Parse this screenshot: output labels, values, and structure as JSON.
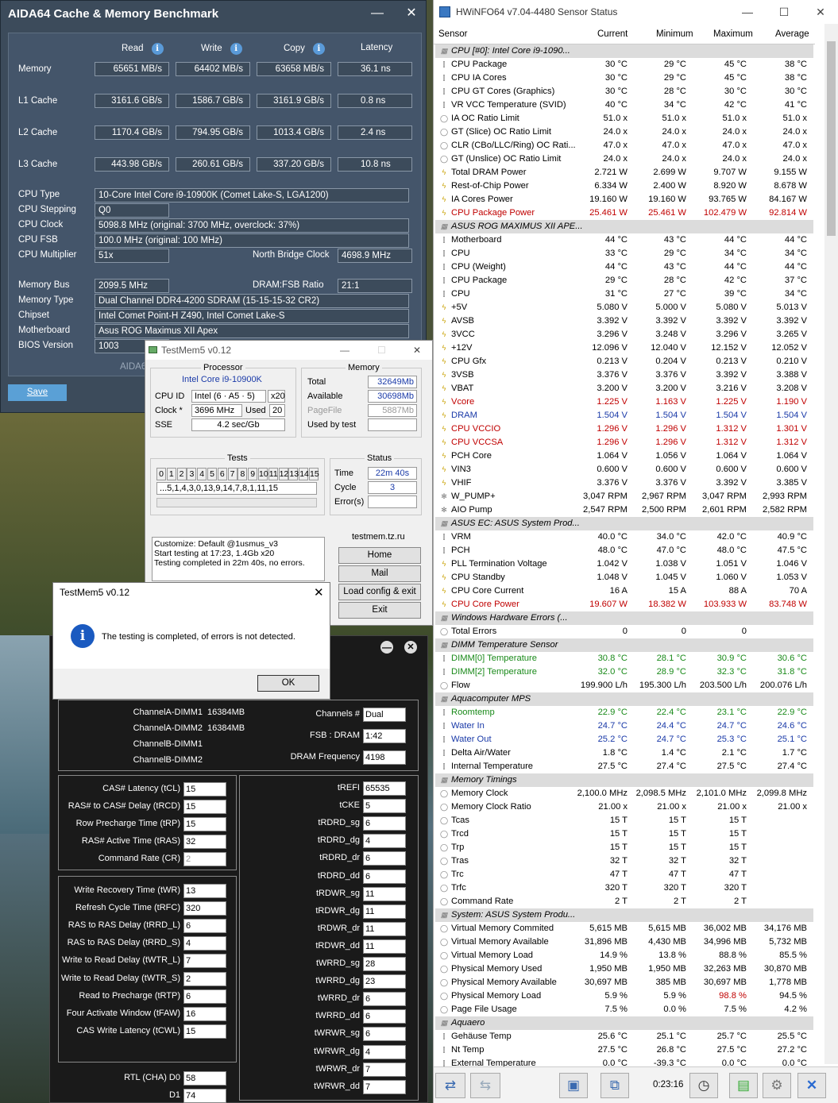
{
  "aida": {
    "title": "AIDA64 Cache & Memory Benchmark",
    "save": "Save",
    "watermark": "AIDA6",
    "cols": {
      "read": "Read",
      "write": "Write",
      "copy": "Copy",
      "latency": "Latency"
    },
    "rows": [
      {
        "label": "Memory",
        "read": "65651 MB/s",
        "write": "64402 MB/s",
        "copy": "63658 MB/s",
        "latency": "36.1 ns"
      },
      {
        "label": "L1 Cache",
        "read": "3161.6 GB/s",
        "write": "1586.7 GB/s",
        "copy": "3161.9 GB/s",
        "latency": "0.8 ns"
      },
      {
        "label": "L2 Cache",
        "read": "1170.4 GB/s",
        "write": "794.95 GB/s",
        "copy": "1013.4 GB/s",
        "latency": "2.4 ns"
      },
      {
        "label": "L3 Cache",
        "read": "443.98 GB/s",
        "write": "260.61 GB/s",
        "copy": "337.20 GB/s",
        "latency": "10.8 ns"
      }
    ],
    "info": {
      "cpu_type_l": "CPU Type",
      "cpu_type": "10-Core Intel Core i9-10900K (Comet Lake-S, LGA1200)",
      "stepping_l": "CPU Stepping",
      "stepping": "Q0",
      "clock_l": "CPU Clock",
      "clock": "5098.8 MHz (original: 3700 MHz, overclock: 37%)",
      "fsb_l": "CPU FSB",
      "fsb": "100.0 MHz (original: 100 MHz)",
      "mult_l": "CPU Multiplier",
      "mult": "51x",
      "nb_l": "North Bridge Clock",
      "nb": "4698.9 MHz",
      "membus_l": "Memory Bus",
      "membus": "2099.5 MHz",
      "ratio_l": "DRAM:FSB Ratio",
      "ratio": "21:1",
      "memtype_l": "Memory Type",
      "memtype": "Dual Channel DDR4-4200 SDRAM (15-15-15-32 CR2)",
      "chipset_l": "Chipset",
      "chipset": "Intel Comet Point-H Z490, Intel Comet Lake-S",
      "mobo_l": "Motherboard",
      "mobo": "Asus ROG Maximus XII Apex",
      "bios_l": "BIOS Version",
      "bios": "1003"
    }
  },
  "hw": {
    "title": "HWiNFO64 v7.04-4480 Sensor Status",
    "cols": [
      "Sensor",
      "Current",
      "Minimum",
      "Maximum",
      "Average"
    ],
    "time": "0:23:16",
    "rows": [
      {
        "s": 1,
        "n": "CPU [#0]: Intel Core i9-1090..."
      },
      {
        "i": "t",
        "n": "CPU Package",
        "c": "30 °C",
        "mi": "29 °C",
        "ma": "45 °C",
        "a": "38 °C"
      },
      {
        "i": "t",
        "n": "CPU IA Cores",
        "c": "30 °C",
        "mi": "29 °C",
        "ma": "45 °C",
        "a": "38 °C"
      },
      {
        "i": "t",
        "n": "CPU GT Cores (Graphics)",
        "c": "30 °C",
        "mi": "28 °C",
        "ma": "30 °C",
        "a": "30 °C"
      },
      {
        "i": "t",
        "n": "VR VCC Temperature (SVID)",
        "c": "40 °C",
        "mi": "34 °C",
        "ma": "42 °C",
        "a": "41 °C"
      },
      {
        "i": "o",
        "n": "IA OC Ratio Limit",
        "c": "51.0 x",
        "mi": "51.0 x",
        "ma": "51.0 x",
        "a": "51.0 x"
      },
      {
        "i": "o",
        "n": "GT (Slice) OC Ratio Limit",
        "c": "24.0 x",
        "mi": "24.0 x",
        "ma": "24.0 x",
        "a": "24.0 x"
      },
      {
        "i": "o",
        "n": "CLR (CBo/LLC/Ring) OC Rati...",
        "c": "47.0 x",
        "mi": "47.0 x",
        "ma": "47.0 x",
        "a": "47.0 x"
      },
      {
        "i": "o",
        "n": "GT (Unslice) OC Ratio Limit",
        "c": "24.0 x",
        "mi": "24.0 x",
        "ma": "24.0 x",
        "a": "24.0 x"
      },
      {
        "i": "p",
        "n": "Total DRAM Power",
        "c": "2.721 W",
        "mi": "2.699 W",
        "ma": "9.707 W",
        "a": "9.155 W"
      },
      {
        "i": "p",
        "n": "Rest-of-Chip Power",
        "c": "6.334 W",
        "mi": "2.400 W",
        "ma": "8.920 W",
        "a": "8.678 W"
      },
      {
        "i": "p",
        "n": "IA Cores Power",
        "c": "19.160 W",
        "mi": "19.160 W",
        "ma": "93.765 W",
        "a": "84.167 W"
      },
      {
        "i": "p",
        "n": "CPU Package Power",
        "c": "25.461 W",
        "mi": "25.461 W",
        "ma": "102.479 W",
        "a": "92.814 W",
        "k": "red"
      },
      {
        "s": 1,
        "n": "ASUS ROG MAXIMUS XII APE..."
      },
      {
        "i": "t",
        "n": "Motherboard",
        "c": "44 °C",
        "mi": "43 °C",
        "ma": "44 °C",
        "a": "44 °C"
      },
      {
        "i": "t",
        "n": "CPU",
        "c": "33 °C",
        "mi": "29 °C",
        "ma": "34 °C",
        "a": "34 °C"
      },
      {
        "i": "t",
        "n": "CPU (Weight)",
        "c": "44 °C",
        "mi": "43 °C",
        "ma": "44 °C",
        "a": "44 °C"
      },
      {
        "i": "t",
        "n": "CPU Package",
        "c": "29 °C",
        "mi": "28 °C",
        "ma": "42 °C",
        "a": "37 °C"
      },
      {
        "i": "t",
        "n": "CPU",
        "c": "31 °C",
        "mi": "27 °C",
        "ma": "39 °C",
        "a": "34 °C"
      },
      {
        "i": "p",
        "n": "+5V",
        "c": "5.080 V",
        "mi": "5.000 V",
        "ma": "5.080 V",
        "a": "5.013 V"
      },
      {
        "i": "p",
        "n": "AVSB",
        "c": "3.392 V",
        "mi": "3.392 V",
        "ma": "3.392 V",
        "a": "3.392 V"
      },
      {
        "i": "p",
        "n": "3VCC",
        "c": "3.296 V",
        "mi": "3.248 V",
        "ma": "3.296 V",
        "a": "3.265 V"
      },
      {
        "i": "p",
        "n": "+12V",
        "c": "12.096 V",
        "mi": "12.040 V",
        "ma": "12.152 V",
        "a": "12.052 V"
      },
      {
        "i": "p",
        "n": "CPU Gfx",
        "c": "0.213 V",
        "mi": "0.204 V",
        "ma": "0.213 V",
        "a": "0.210 V"
      },
      {
        "i": "p",
        "n": "3VSB",
        "c": "3.376 V",
        "mi": "3.376 V",
        "ma": "3.392 V",
        "a": "3.388 V"
      },
      {
        "i": "p",
        "n": "VBAT",
        "c": "3.200 V",
        "mi": "3.200 V",
        "ma": "3.216 V",
        "a": "3.208 V"
      },
      {
        "i": "p",
        "n": "Vcore",
        "c": "1.225 V",
        "mi": "1.163 V",
        "ma": "1.225 V",
        "a": "1.190 V",
        "k": "red"
      },
      {
        "i": "p",
        "n": "DRAM",
        "c": "1.504 V",
        "mi": "1.504 V",
        "ma": "1.504 V",
        "a": "1.504 V",
        "k": "blue"
      },
      {
        "i": "p",
        "n": "CPU VCCIO",
        "c": "1.296 V",
        "mi": "1.296 V",
        "ma": "1.312 V",
        "a": "1.301 V",
        "k": "red"
      },
      {
        "i": "p",
        "n": "CPU VCCSA",
        "c": "1.296 V",
        "mi": "1.296 V",
        "ma": "1.312 V",
        "a": "1.312 V",
        "k": "red"
      },
      {
        "i": "p",
        "n": "PCH Core",
        "c": "1.064 V",
        "mi": "1.056 V",
        "ma": "1.064 V",
        "a": "1.064 V"
      },
      {
        "i": "p",
        "n": "VIN3",
        "c": "0.600 V",
        "mi": "0.600 V",
        "ma": "0.600 V",
        "a": "0.600 V"
      },
      {
        "i": "p",
        "n": "VHIF",
        "c": "3.376 V",
        "mi": "3.376 V",
        "ma": "3.392 V",
        "a": "3.385 V"
      },
      {
        "i": "f",
        "n": "W_PUMP+",
        "c": "3,047 RPM",
        "mi": "2,967 RPM",
        "ma": "3,047 RPM",
        "a": "2,993 RPM"
      },
      {
        "i": "f",
        "n": "AIO Pump",
        "c": "2,547 RPM",
        "mi": "2,500 RPM",
        "ma": "2,601 RPM",
        "a": "2,582 RPM"
      },
      {
        "s": 1,
        "n": "ASUS EC: ASUS System Prod..."
      },
      {
        "i": "t",
        "n": "VRM",
        "c": "40.0 °C",
        "mi": "34.0 °C",
        "ma": "42.0 °C",
        "a": "40.9 °C"
      },
      {
        "i": "t",
        "n": "PCH",
        "c": "48.0 °C",
        "mi": "47.0 °C",
        "ma": "48.0 °C",
        "a": "47.5 °C"
      },
      {
        "i": "p",
        "n": "PLL Termination Voltage",
        "c": "1.042 V",
        "mi": "1.038 V",
        "ma": "1.051 V",
        "a": "1.046 V"
      },
      {
        "i": "p",
        "n": "CPU Standby",
        "c": "1.048 V",
        "mi": "1.045 V",
        "ma": "1.060 V",
        "a": "1.053 V"
      },
      {
        "i": "p",
        "n": "CPU Core Current",
        "c": "16 A",
        "mi": "15 A",
        "ma": "88 A",
        "a": "70 A"
      },
      {
        "i": "p",
        "n": "CPU Core Power",
        "c": "19.607 W",
        "mi": "18.382 W",
        "ma": "103.933 W",
        "a": "83.748 W",
        "k": "red"
      },
      {
        "s": 1,
        "n": "Windows Hardware Errors (..."
      },
      {
        "i": "o",
        "n": "Total Errors",
        "c": "0",
        "mi": "0",
        "ma": "0",
        "a": ""
      },
      {
        "s": 1,
        "n": "DIMM Temperature Sensor"
      },
      {
        "i": "t",
        "n": "DIMM[0] Temperature",
        "c": "30.8 °C",
        "mi": "28.1 °C",
        "ma": "30.9 °C",
        "a": "30.6 °C",
        "k": "green"
      },
      {
        "i": "t",
        "n": "DIMM[2] Temperature",
        "c": "32.0 °C",
        "mi": "28.9 °C",
        "ma": "32.3 °C",
        "a": "31.8 °C",
        "k": "green"
      },
      {
        "i": "o",
        "n": "Flow",
        "c": "199.900 L/h",
        "mi": "195.300 L/h",
        "ma": "203.500 L/h",
        "a": "200.076 L/h"
      },
      {
        "s": 1,
        "n": "Aquacomputer MPS"
      },
      {
        "i": "t",
        "n": "Roomtemp",
        "c": "22.9 °C",
        "mi": "22.4 °C",
        "ma": "23.1 °C",
        "a": "22.9 °C",
        "k": "green"
      },
      {
        "i": "t",
        "n": "Water In",
        "c": "24.7 °C",
        "mi": "24.4 °C",
        "ma": "24.7 °C",
        "a": "24.6 °C",
        "k": "blue"
      },
      {
        "i": "t",
        "n": "Water Out",
        "c": "25.2 °C",
        "mi": "24.7 °C",
        "ma": "25.3 °C",
        "a": "25.1 °C",
        "k": "blue"
      },
      {
        "i": "t",
        "n": "Delta Air/Water",
        "c": "1.8 °C",
        "mi": "1.4 °C",
        "ma": "2.1 °C",
        "a": "1.7 °C"
      },
      {
        "i": "t",
        "n": "Internal Temperature",
        "c": "27.5 °C",
        "mi": "27.4 °C",
        "ma": "27.5 °C",
        "a": "27.4 °C"
      },
      {
        "s": 1,
        "n": "Memory Timings"
      },
      {
        "i": "o",
        "n": "Memory Clock",
        "c": "2,100.0 MHz",
        "mi": "2,098.5 MHz",
        "ma": "2,101.0 MHz",
        "a": "2,099.8 MHz"
      },
      {
        "i": "o",
        "n": "Memory Clock Ratio",
        "c": "21.00 x",
        "mi": "21.00 x",
        "ma": "21.00 x",
        "a": "21.00 x"
      },
      {
        "i": "o",
        "n": "Tcas",
        "c": "15 T",
        "mi": "15 T",
        "ma": "15 T",
        "a": ""
      },
      {
        "i": "o",
        "n": "Trcd",
        "c": "15 T",
        "mi": "15 T",
        "ma": "15 T",
        "a": ""
      },
      {
        "i": "o",
        "n": "Trp",
        "c": "15 T",
        "mi": "15 T",
        "ma": "15 T",
        "a": ""
      },
      {
        "i": "o",
        "n": "Tras",
        "c": "32 T",
        "mi": "32 T",
        "ma": "32 T",
        "a": ""
      },
      {
        "i": "o",
        "n": "Trc",
        "c": "47 T",
        "mi": "47 T",
        "ma": "47 T",
        "a": ""
      },
      {
        "i": "o",
        "n": "Trfc",
        "c": "320 T",
        "mi": "320 T",
        "ma": "320 T",
        "a": ""
      },
      {
        "i": "o",
        "n": "Command Rate",
        "c": "2 T",
        "mi": "2 T",
        "ma": "2 T",
        "a": ""
      },
      {
        "s": 1,
        "n": "System: ASUS System Produ..."
      },
      {
        "i": "o",
        "n": "Virtual Memory Commited",
        "c": "5,615 MB",
        "mi": "5,615 MB",
        "ma": "36,002 MB",
        "a": "34,176 MB"
      },
      {
        "i": "o",
        "n": "Virtual Memory Available",
        "c": "31,896 MB",
        "mi": "4,430 MB",
        "ma": "34,996 MB",
        "a": "5,732 MB"
      },
      {
        "i": "o",
        "n": "Virtual Memory Load",
        "c": "14.9 %",
        "mi": "13.8 %",
        "ma": "88.8 %",
        "a": "85.5 %"
      },
      {
        "i": "o",
        "n": "Physical Memory Used",
        "c": "1,950 MB",
        "mi": "1,950 MB",
        "ma": "32,263 MB",
        "a": "30,870 MB"
      },
      {
        "i": "o",
        "n": "Physical Memory Available",
        "c": "30,697 MB",
        "mi": "385 MB",
        "ma": "30,697 MB",
        "a": "1,778 MB"
      },
      {
        "i": "o",
        "n": "Physical Memory Load",
        "c": "5.9 %",
        "mi": "5.9 %",
        "ma": "98.8 %",
        "a": "94.5 %",
        "mk": "red"
      },
      {
        "i": "o",
        "n": "Page File Usage",
        "c": "7.5 %",
        "mi": "0.0 %",
        "ma": "7.5 %",
        "a": "4.2 %"
      },
      {
        "s": 1,
        "n": "Aquaero"
      },
      {
        "i": "t",
        "n": "Gehäuse Temp",
        "c": "25.6 °C",
        "mi": "25.1 °C",
        "ma": "25.7 °C",
        "a": "25.5 °C"
      },
      {
        "i": "t",
        "n": "Nt Temp",
        "c": "27.5 °C",
        "mi": "26.8 °C",
        "ma": "27.5 °C",
        "a": "27.2 °C"
      },
      {
        "i": "t",
        "n": "External Temperature",
        "c": "0.0 °C",
        "mi": "-39.3 °C",
        "ma": "0.0 °C",
        "a": "0.0 °C"
      }
    ]
  },
  "tm": {
    "title": "TestMem5 v0.12",
    "processor_t": "Processor",
    "cpu": "Intel Core i9-10900K",
    "cpuid_l": "CPU ID",
    "cpuid": "Intel (6 · A5 · 5)",
    "threads": "x20",
    "clock_l": "Clock *",
    "clock": "3696 MHz",
    "used_l": "Used",
    "used": "20",
    "sse_l": "SSE",
    "sse": "4.2 sec/Gb",
    "memory_t": "Memory",
    "total_l": "Total",
    "total": "32649Mb",
    "avail_l": "Available",
    "avail": "30698Mb",
    "pf_l": "PageFile",
    "pf": "5887Mb",
    "ubt_l": "Used by test",
    "ubt": "",
    "tests_t": "Tests",
    "tests": [
      "0",
      "1",
      "2",
      "3",
      "4",
      "5",
      "6",
      "7",
      "8",
      "9",
      "10",
      "11",
      "12",
      "13",
      "14",
      "15"
    ],
    "seq": "...5,1,4,3,0,13,9,14,7,8,1,11,15",
    "status_t": "Status",
    "time_l": "Time",
    "time": "22m 40s",
    "cycle_l": "Cycle",
    "cycle": "3",
    "err_l": "Error(s)",
    "err": "",
    "log": [
      "Customize: Default @1usmus_v3",
      "Start testing at 17:23, 1.4Gb x20",
      "Testing completed in 22m 40s, no errors."
    ],
    "site": "testmem.tz.ru",
    "home": "Home",
    "mail": "Mail",
    "load": "Load config & exit",
    "exit": "Exit"
  },
  "dlg": {
    "title": "TestMem5 v0.12",
    "msg": "The testing is completed, of errors is not detected.",
    "ok": "OK"
  },
  "timings": {
    "ch": [
      {
        "l": "ChannelA-DIMM1",
        "v": "16384MB"
      },
      {
        "l": "ChannelA-DIMM2",
        "v": "16384MB"
      },
      {
        "l": "ChannelB-DIMM1",
        "v": ""
      },
      {
        "l": "ChannelB-DIMM2",
        "v": ""
      }
    ],
    "channels_l": "Channels #",
    "channels": "Dual",
    "fsb_l": "FSB : DRAM",
    "fsb": "1:42",
    "freq_l": "DRAM Frequency",
    "freq": "4198",
    "left1": [
      {
        "l": "CAS# Latency (tCL)",
        "v": "15"
      },
      {
        "l": "RAS# to CAS# Delay (tRCD)",
        "v": "15"
      },
      {
        "l": "Row Precharge Time (tRP)",
        "v": "15"
      },
      {
        "l": "RAS# Active Time (tRAS)",
        "v": "32"
      },
      {
        "l": "Command Rate (CR)",
        "v": "2",
        "g": 1
      }
    ],
    "left2": [
      {
        "l": "Write Recovery Time (tWR)",
        "v": "13"
      },
      {
        "l": "Refresh Cycle Time (tRFC)",
        "v": "320"
      },
      {
        "l": "RAS to RAS Delay (tRRD_L)",
        "v": "6"
      },
      {
        "l": "RAS to RAS Delay (tRRD_S)",
        "v": "4"
      },
      {
        "l": "Write to Read Delay (tWTR_L)",
        "v": "7"
      },
      {
        "l": "Write to Read Delay (tWTR_S)",
        "v": "2"
      },
      {
        "l": "Read to Precharge (tRTP)",
        "v": "6"
      },
      {
        "l": "Four Activate Window (tFAW)",
        "v": "16"
      },
      {
        "l": "CAS Write Latency (tCWL)",
        "v": "15"
      }
    ],
    "right": [
      {
        "l": "tREFI",
        "v": "65535"
      },
      {
        "l": "tCKE",
        "v": "5"
      },
      {
        "l": "tRDRD_sg",
        "v": "6"
      },
      {
        "l": "tRDRD_dg",
        "v": "4"
      },
      {
        "l": "tRDRD_dr",
        "v": "6"
      },
      {
        "l": "tRDRD_dd",
        "v": "6"
      },
      {
        "l": "tRDWR_sg",
        "v": "11"
      },
      {
        "l": "tRDWR_dg",
        "v": "11"
      },
      {
        "l": "tRDWR_dr",
        "v": "11"
      },
      {
        "l": "tRDWR_dd",
        "v": "11"
      },
      {
        "l": "tWRRD_sg",
        "v": "28"
      },
      {
        "l": "tWRRD_dg",
        "v": "23"
      },
      {
        "l": "tWRRD_dr",
        "v": "6"
      },
      {
        "l": "tWRRD_dd",
        "v": "6"
      },
      {
        "l": "tWRWR_sg",
        "v": "6"
      },
      {
        "l": "tWRWR_dg",
        "v": "4"
      },
      {
        "l": "tWRWR_dr",
        "v": "7"
      },
      {
        "l": "tWRWR_dd",
        "v": "7"
      }
    ],
    "rtl": [
      {
        "l": "RTL (CHA) D0",
        "v": "58"
      },
      {
        "l": "D1",
        "v": "74"
      }
    ]
  }
}
